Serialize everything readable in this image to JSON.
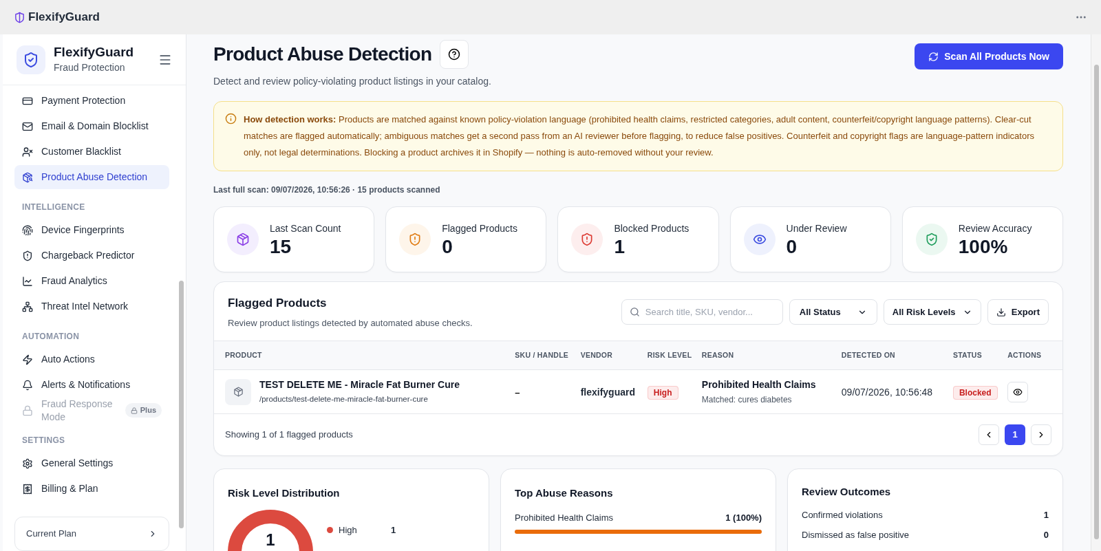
{
  "window": {
    "title": "FlexifyGuard"
  },
  "sidebar": {
    "brand": "FlexifyGuard",
    "tagline": "Fraud Protection",
    "sections": [
      {
        "items": [
          {
            "label": "Payment Protection",
            "selected": false,
            "disabled": false
          },
          {
            "label": "Email & Domain Blocklist",
            "selected": false,
            "disabled": false
          },
          {
            "label": "Customer Blacklist",
            "selected": false,
            "disabled": false
          },
          {
            "label": "Product Abuse Detection",
            "selected": true,
            "disabled": false
          }
        ]
      },
      {
        "heading": "INTELLIGENCE",
        "items": [
          {
            "label": "Device Fingerprints",
            "selected": false,
            "disabled": false
          },
          {
            "label": "Chargeback Predictor",
            "selected": false,
            "disabled": false
          },
          {
            "label": "Fraud Analytics",
            "selected": false,
            "disabled": false
          },
          {
            "label": "Threat Intel Network",
            "selected": false,
            "disabled": false
          }
        ]
      },
      {
        "heading": "AUTOMATION",
        "items": [
          {
            "label": "Auto Actions",
            "selected": false,
            "disabled": false
          },
          {
            "label": "Alerts & Notifications",
            "selected": false,
            "disabled": false
          },
          {
            "label": "Fraud Response Mode",
            "selected": false,
            "disabled": true,
            "badge": "Plus"
          }
        ]
      },
      {
        "heading": "SETTINGS",
        "items": [
          {
            "label": "General Settings",
            "selected": false,
            "disabled": false
          },
          {
            "label": "Billing & Plan",
            "selected": false,
            "disabled": false
          }
        ]
      }
    ],
    "plan_card": {
      "label": "Current Plan"
    }
  },
  "page": {
    "title": "Product Abuse Detection",
    "subtitle": "Detect and review policy-violating product listings in your catalog.",
    "scan_button": "Scan All Products Now"
  },
  "notice": {
    "text": "**How detection works:** Products are matched against known policy-violation language (prohibited health claims, restricted categories, adult content, counterfeit/copyright language patterns). Clear-cut matches are flagged automatically; ambiguous matches get a second pass from an AI reviewer before flagging, to reduce false positives. Counterfeit and copyright flags are language-pattern indicators only, not legal determinations. Blocking a product archives it in Shopify — nothing is auto-removed without your review."
  },
  "last_scan": "Last full scan: 09/07/2026, 10:56:26 · 15 products scanned",
  "stats": [
    {
      "label": "Last Scan Count",
      "value": "15"
    },
    {
      "label": "Flagged Products",
      "value": "0"
    },
    {
      "label": "Blocked Products",
      "value": "1"
    },
    {
      "label": "Under Review",
      "value": "0"
    },
    {
      "label": "Review Accuracy",
      "value": "100%"
    }
  ],
  "flagged": {
    "title": "Flagged Products",
    "subtitle": "Review product listings detected by automated abuse checks.",
    "search": {
      "placeholder": "Search title, SKU, vendor..."
    },
    "status_filter": "All Status",
    "risk_filter": "All Risk Levels",
    "export_button": "Export",
    "columns": [
      "PRODUCT",
      "SKU / HANDLE",
      "VENDOR",
      "RISK LEVEL",
      "REASON",
      "DETECTED ON",
      "STATUS",
      "ACTIONS"
    ],
    "rows": [
      {
        "product": "TEST DELETE ME - Miracle Fat Burner Cure",
        "handle": "/products/test-delete-me-miracle-fat-burner-cure",
        "sku": "–",
        "vendor": "flexifyguard",
        "risk": "High",
        "reason": "Prohibited Health Claims",
        "matched": "Matched: cures diabetes",
        "detected": "09/07/2026, 10:56:48",
        "status": "Blocked"
      }
    ],
    "footer": "Showing 1 of 1 flagged products",
    "pages": [
      {
        "label": "1",
        "selected": true
      }
    ]
  },
  "risk_distribution": {
    "title": "Risk Level Distribution",
    "center": "1",
    "legend": [
      {
        "label": "High",
        "count": "1",
        "color": "#dc4a3f"
      }
    ]
  },
  "top_reasons": {
    "title": "Top Abuse Reasons",
    "items": [
      {
        "label": "Prohibited Health Claims",
        "value": "1 (100%)",
        "level": 1.0
      }
    ]
  },
  "review_outcomes": {
    "title": "Review Outcomes",
    "rows": [
      {
        "label": "Confirmed violations",
        "value": "1"
      },
      {
        "label": "Dismissed as false positive",
        "value": "0"
      }
    ]
  }
}
